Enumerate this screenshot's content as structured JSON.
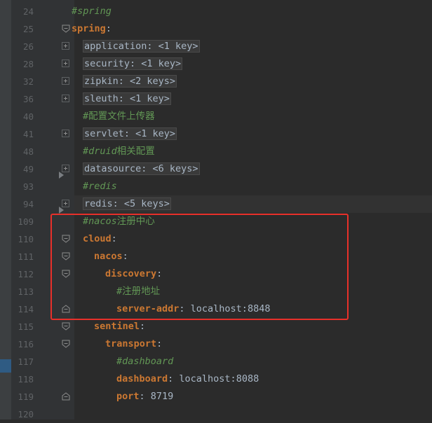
{
  "editor": {
    "lines": [
      {
        "num": "24",
        "indent": 0,
        "fold": "none",
        "segments": [
          {
            "t": "#spring",
            "c": "comment"
          }
        ]
      },
      {
        "num": "25",
        "indent": 0,
        "fold": "open",
        "segments": [
          {
            "t": "spring",
            "c": "key"
          },
          {
            "t": ":",
            "c": "plain"
          }
        ]
      },
      {
        "num": "26",
        "indent": 1,
        "fold": "plus",
        "segments": [
          {
            "t": "application: <1 key>",
            "c": "collapsed"
          }
        ]
      },
      {
        "num": "28",
        "indent": 1,
        "fold": "plus",
        "segments": [
          {
            "t": "security: <1 key>",
            "c": "collapsed"
          }
        ]
      },
      {
        "num": "32",
        "indent": 1,
        "fold": "plus",
        "segments": [
          {
            "t": "zipkin: <2 keys>",
            "c": "collapsed"
          }
        ]
      },
      {
        "num": "36",
        "indent": 1,
        "fold": "plus",
        "segments": [
          {
            "t": "sleuth: <1 key>",
            "c": "collapsed"
          }
        ]
      },
      {
        "num": "40",
        "indent": 1,
        "fold": "none",
        "segments": [
          {
            "t": "#配置文件上传器",
            "c": "comment-cn"
          }
        ]
      },
      {
        "num": "41",
        "indent": 1,
        "fold": "plus",
        "segments": [
          {
            "t": "servlet: <1 key>",
            "c": "collapsed"
          }
        ]
      },
      {
        "num": "48",
        "indent": 1,
        "fold": "none",
        "segments": [
          {
            "t": "#druid",
            "c": "comment"
          },
          {
            "t": "相关配置",
            "c": "comment-cn"
          }
        ]
      },
      {
        "num": "49",
        "indent": 1,
        "fold": "plus",
        "segments": [
          {
            "t": "datasource: <6 keys>",
            "c": "collapsed"
          }
        ]
      },
      {
        "num": "93",
        "indent": 1,
        "fold": "none",
        "segments": [
          {
            "t": "#redis",
            "c": "comment"
          }
        ]
      },
      {
        "num": "94",
        "indent": 1,
        "fold": "plus",
        "segments": [
          {
            "t": "redis: <5 keys>",
            "c": "collapsed"
          }
        ]
      },
      {
        "num": "109",
        "indent": 1,
        "fold": "none",
        "segments": [
          {
            "t": "#nacos",
            "c": "comment"
          },
          {
            "t": "注册中心",
            "c": "comment-cn"
          }
        ]
      },
      {
        "num": "110",
        "indent": 1,
        "fold": "open",
        "segments": [
          {
            "t": "cloud",
            "c": "key"
          },
          {
            "t": ":",
            "c": "plain"
          }
        ]
      },
      {
        "num": "111",
        "indent": 2,
        "fold": "open",
        "segments": [
          {
            "t": "nacos",
            "c": "key"
          },
          {
            "t": ":",
            "c": "plain"
          }
        ]
      },
      {
        "num": "112",
        "indent": 3,
        "fold": "open",
        "segments": [
          {
            "t": "discovery",
            "c": "key"
          },
          {
            "t": ":",
            "c": "plain"
          }
        ]
      },
      {
        "num": "113",
        "indent": 4,
        "fold": "none",
        "segments": [
          {
            "t": "#注册地址",
            "c": "comment-cn"
          }
        ]
      },
      {
        "num": "114",
        "indent": 4,
        "fold": "end",
        "segments": [
          {
            "t": "server-addr",
            "c": "key"
          },
          {
            "t": ": localhost:8848",
            "c": "val"
          }
        ]
      },
      {
        "num": "115",
        "indent": 2,
        "fold": "open",
        "segments": [
          {
            "t": "sentinel",
            "c": "key"
          },
          {
            "t": ":",
            "c": "plain"
          }
        ]
      },
      {
        "num": "116",
        "indent": 3,
        "fold": "open",
        "segments": [
          {
            "t": "transport",
            "c": "key"
          },
          {
            "t": ":",
            "c": "plain"
          }
        ]
      },
      {
        "num": "117",
        "indent": 4,
        "fold": "none",
        "segments": [
          {
            "t": "#dashboard",
            "c": "comment"
          }
        ]
      },
      {
        "num": "118",
        "indent": 4,
        "fold": "none",
        "segments": [
          {
            "t": "dashboard",
            "c": "key"
          },
          {
            "t": ": localhost:8088",
            "c": "val"
          }
        ]
      },
      {
        "num": "119",
        "indent": 4,
        "fold": "end",
        "segments": [
          {
            "t": "port",
            "c": "key"
          },
          {
            "t": ": 8719",
            "c": "val"
          }
        ]
      },
      {
        "num": "120",
        "indent": 0,
        "fold": "none",
        "segments": []
      }
    ]
  },
  "colors": {
    "background": "#2b2b2b",
    "gutter": "#313335",
    "key": "#cc7832",
    "comment": "#629755",
    "text": "#a9b7c6",
    "highlight_border": "#e8302a"
  }
}
